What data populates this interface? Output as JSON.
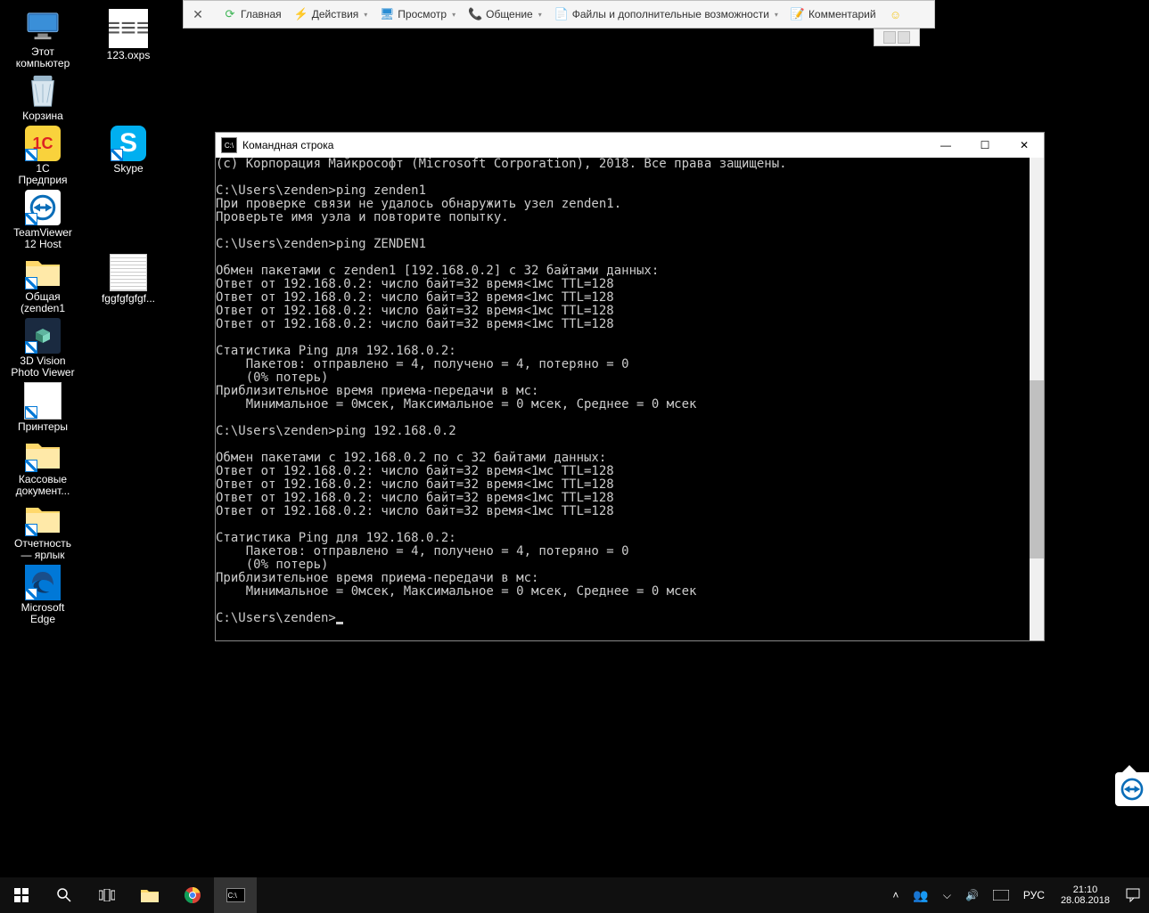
{
  "rc_toolbar": {
    "items": [
      {
        "label": "Главная",
        "icon": "refresh",
        "color": "#3eb556"
      },
      {
        "label": "Действия",
        "icon": "bolt",
        "color": "#f5a623",
        "caret": true
      },
      {
        "label": "Просмотр",
        "icon": "monitor",
        "color": "#2a8dd4",
        "caret": true
      },
      {
        "label": "Общение",
        "icon": "phone",
        "color": "#2a8dd4",
        "caret": true
      },
      {
        "label": "Файлы и дополнительные возможности",
        "icon": "file",
        "color": "#2a8dd4",
        "caret": true
      },
      {
        "label": "Комментарий",
        "icon": "note",
        "color": "#2a8dd4"
      },
      {
        "label": "",
        "icon": "smile",
        "color": "#f5c518"
      }
    ]
  },
  "desktop": {
    "col1": [
      {
        "name": "Этот\nкомпьютер",
        "icon": "monitor"
      },
      {
        "name": "Корзина",
        "icon": "bin"
      },
      {
        "name": "1С\nПредприя",
        "icon": "1c",
        "shortcut": true
      },
      {
        "name": "TeamViewer\n12 Host",
        "icon": "tv",
        "shortcut": true
      },
      {
        "name": "Общая\n(zenden1",
        "icon": "folder",
        "shortcut": true
      },
      {
        "name": "3D Vision\nPhoto Viewer",
        "icon": "3d",
        "shortcut": true
      },
      {
        "name": "Принтеры",
        "icon": "printer",
        "shortcut": true
      },
      {
        "name": "Кассовые\nдокумент...",
        "icon": "folder",
        "shortcut": true
      },
      {
        "name": "Отчетность\n— ярлык",
        "icon": "folder",
        "shortcut": true
      },
      {
        "name": "Microsoft\nEdge",
        "icon": "edge",
        "shortcut": true
      }
    ],
    "col2": [
      {
        "name": "123.oxps",
        "icon": "doc"
      },
      {
        "name": "",
        "icon": ""
      },
      {
        "name": "Skype",
        "icon": "skype",
        "shortcut": true
      },
      {
        "name": "",
        "icon": ""
      },
      {
        "name": "fggfgfgfgf...",
        "icon": "docfile"
      }
    ]
  },
  "cmd": {
    "title": "Командная строка",
    "lines": [
      "(c) Корпорация Майкрософт (Microsoft Corporation), 2018. Все права защищены.",
      "",
      "C:\\Users\\zenden>ping zenden1",
      "При проверке связи не удалось обнаружить узел zenden1.",
      "Проверьте имя уэла и повторите попытку.",
      "",
      "C:\\Users\\zenden>ping ZENDEN1",
      "",
      "Обмен пакетами с zenden1 [192.168.0.2] с 32 байтами данных:",
      "Ответ от 192.168.0.2: число байт=32 время<1мс TTL=128",
      "Ответ от 192.168.0.2: число байт=32 время<1мс TTL=128",
      "Ответ от 192.168.0.2: число байт=32 время<1мс TTL=128",
      "Ответ от 192.168.0.2: число байт=32 время<1мс TTL=128",
      "",
      "Статистика Ping для 192.168.0.2:",
      "    Пакетов: отправлено = 4, получено = 4, потеряно = 0",
      "    (0% потерь)",
      "Приблизительное время приема-передачи в мс:",
      "    Минимальное = 0мсек, Максимальное = 0 мсек, Среднее = 0 мсек",
      "",
      "C:\\Users\\zenden>ping 192.168.0.2",
      "",
      "Обмен пакетами с 192.168.0.2 по с 32 байтами данных:",
      "Ответ от 192.168.0.2: число байт=32 время<1мс TTL=128",
      "Ответ от 192.168.0.2: число байт=32 время<1мс TTL=128",
      "Ответ от 192.168.0.2: число байт=32 время<1мс TTL=128",
      "Ответ от 192.168.0.2: число байт=32 время<1мс TTL=128",
      "",
      "Статистика Ping для 192.168.0.2:",
      "    Пакетов: отправлено = 4, получено = 4, потеряно = 0",
      "    (0% потерь)",
      "Приблизительное время приема-передачи в мс:",
      "    Минимальное = 0мсек, Максимальное = 0 мсек, Среднее = 0 мсек",
      "",
      "C:\\Users\\zenden>"
    ]
  },
  "taskbar": {
    "lang": "РУС",
    "time": "21:10",
    "date": "28.08.2018"
  }
}
